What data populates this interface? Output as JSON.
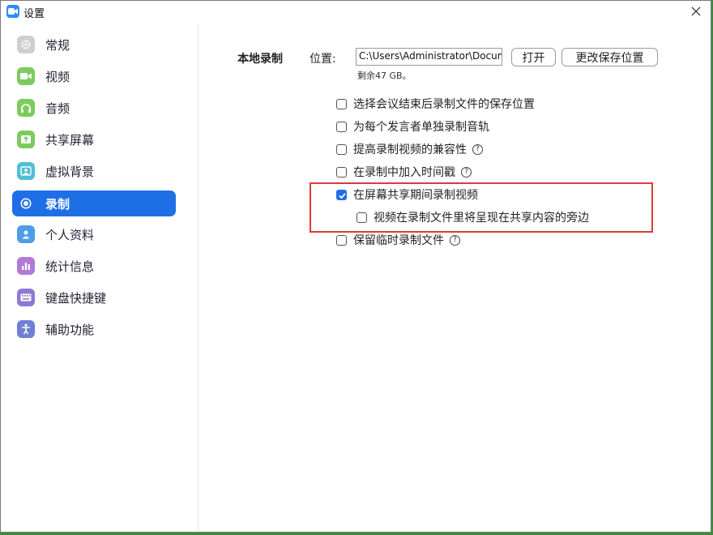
{
  "window": {
    "title": "设置"
  },
  "sidebar": {
    "items": [
      {
        "label": "常规",
        "icon": "gear-icon",
        "color": "#c8c8c8"
      },
      {
        "label": "视频",
        "icon": "video-camera-icon",
        "color": "#7ccb5e"
      },
      {
        "label": "音频",
        "icon": "headphones-icon",
        "color": "#7ccb5e"
      },
      {
        "label": "共享屏幕",
        "icon": "share-screen-icon",
        "color": "#7ccb5e"
      },
      {
        "label": "虚拟背景",
        "icon": "virtual-background-icon",
        "color": "#4fbfd6"
      },
      {
        "label": "录制",
        "icon": "record-icon",
        "color": "#1e6fe6",
        "active": true
      },
      {
        "label": "个人资料",
        "icon": "profile-icon",
        "color": "#4d9de8"
      },
      {
        "label": "统计信息",
        "icon": "statistics-icon",
        "color": "#b07ad6"
      },
      {
        "label": "键盘快捷键",
        "icon": "keyboard-icon",
        "color": "#8c7ad6"
      },
      {
        "label": "辅助功能",
        "icon": "accessibility-icon",
        "color": "#6f7fd6"
      }
    ]
  },
  "recording": {
    "section_title": "本地录制",
    "location_label": "位置:",
    "path_value": "C:\\Users\\Administrator\\Documents",
    "open_button": "打开",
    "change_button": "更改保存位置",
    "free_space": "剩余47 GB。",
    "options": [
      {
        "label": "选择会议结束后录制文件的保存位置",
        "checked": false,
        "help": false
      },
      {
        "label": "为每个发言者单独录制音轨",
        "checked": false,
        "help": false
      },
      {
        "label": "提高录制视频的兼容性",
        "checked": false,
        "help": true
      },
      {
        "label": "在录制中加入时间戳",
        "checked": false,
        "help": true
      },
      {
        "label": "在屏幕共享期间录制视频",
        "checked": true,
        "help": false
      },
      {
        "label": "视频在录制文件里将呈现在共享内容的旁边",
        "checked": false,
        "help": false
      },
      {
        "label": "保留临时录制文件",
        "checked": false,
        "help": true
      }
    ]
  },
  "colors": {
    "accent": "#1e6fe6",
    "highlight_border": "#e0393a"
  }
}
